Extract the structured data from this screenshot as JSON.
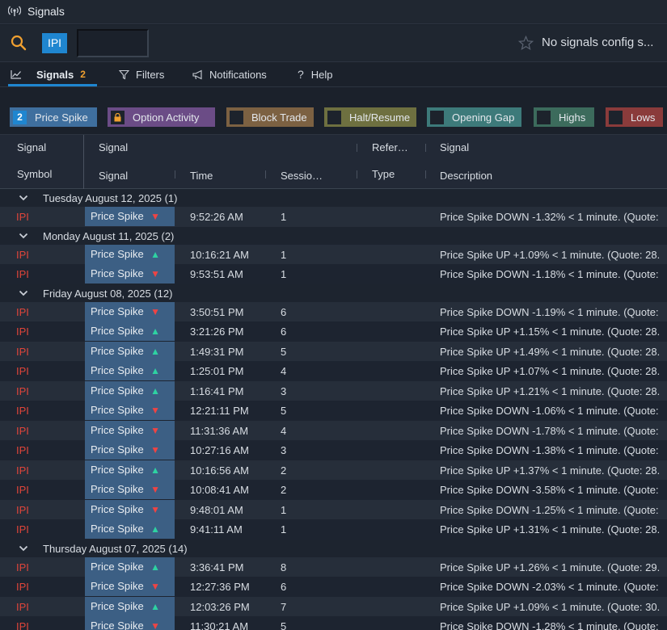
{
  "window": {
    "title": "Signals"
  },
  "symbol_bar": {
    "symbol": "IPI",
    "config_text": "No signals config s..."
  },
  "tabs": [
    {
      "label": "Signals",
      "count": "2"
    },
    {
      "label": "Filters"
    },
    {
      "label": "Notifications"
    },
    {
      "label": "Help"
    }
  ],
  "chips": {
    "price_spike": {
      "label": "Price Spike",
      "count": "2"
    },
    "option_activity": {
      "label": "Option Activity"
    },
    "block_trade": {
      "label": "Block Trade"
    },
    "halt_resume": {
      "label": "Halt/Resume"
    },
    "opening_gap": {
      "label": "Opening Gap"
    },
    "highs": {
      "label": "Highs"
    },
    "lows": {
      "label": "Lows"
    }
  },
  "grid": {
    "header_top": {
      "c1": "Signal",
      "c2": "Signal",
      "c3": "Refer…",
      "c4": "Signal"
    },
    "header_bottom": {
      "c1": "Symbol",
      "c2": "Signal",
      "c3": "Time",
      "c4": "Sessio…",
      "c5": "Type",
      "c6": "Description"
    }
  },
  "groups": [
    {
      "title": "Tuesday August 12, 2025",
      "count": "(1)",
      "rows": [
        {
          "symbol": "IPI",
          "signal": "Price Spike",
          "dir": "down",
          "time": "9:52:26 AM",
          "session": "1",
          "desc": "Price Spike DOWN -1.32% < 1 minute. (Quote:"
        }
      ]
    },
    {
      "title": "Monday August 11, 2025",
      "count": "(2)",
      "rows": [
        {
          "symbol": "IPI",
          "signal": "Price Spike",
          "dir": "up",
          "time": "10:16:21 AM",
          "session": "1",
          "desc": "Price Spike UP +1.09% < 1 minute. (Quote: 28."
        },
        {
          "symbol": "IPI",
          "signal": "Price Spike",
          "dir": "down",
          "time": "9:53:51 AM",
          "session": "1",
          "desc": "Price Spike DOWN -1.18% < 1 minute. (Quote:"
        }
      ]
    },
    {
      "title": "Friday August 08, 2025",
      "count": "(12)",
      "rows": [
        {
          "symbol": "IPI",
          "signal": "Price Spike",
          "dir": "down",
          "time": "3:50:51 PM",
          "session": "6",
          "desc": "Price Spike DOWN -1.19% < 1 minute. (Quote:"
        },
        {
          "symbol": "IPI",
          "signal": "Price Spike",
          "dir": "up",
          "time": "3:21:26 PM",
          "session": "6",
          "desc": "Price Spike UP +1.15% < 1 minute. (Quote: 28."
        },
        {
          "symbol": "IPI",
          "signal": "Price Spike",
          "dir": "up",
          "time": "1:49:31 PM",
          "session": "5",
          "desc": "Price Spike UP +1.49% < 1 minute. (Quote: 28."
        },
        {
          "symbol": "IPI",
          "signal": "Price Spike",
          "dir": "up",
          "time": "1:25:01 PM",
          "session": "4",
          "desc": "Price Spike UP +1.07% < 1 minute. (Quote: 28."
        },
        {
          "symbol": "IPI",
          "signal": "Price Spike",
          "dir": "up",
          "time": "1:16:41 PM",
          "session": "3",
          "desc": "Price Spike UP +1.21% < 1 minute. (Quote: 28."
        },
        {
          "symbol": "IPI",
          "signal": "Price Spike",
          "dir": "down",
          "time": "12:21:11 PM",
          "session": "5",
          "desc": "Price Spike DOWN -1.06% < 1 minute. (Quote:"
        },
        {
          "symbol": "IPI",
          "signal": "Price Spike",
          "dir": "down",
          "time": "11:31:36 AM",
          "session": "4",
          "desc": "Price Spike DOWN -1.78% < 1 minute. (Quote:"
        },
        {
          "symbol": "IPI",
          "signal": "Price Spike",
          "dir": "down",
          "time": "10:27:16 AM",
          "session": "3",
          "desc": "Price Spike DOWN -1.38% < 1 minute. (Quote:"
        },
        {
          "symbol": "IPI",
          "signal": "Price Spike",
          "dir": "up",
          "time": "10:16:56 AM",
          "session": "2",
          "desc": "Price Spike UP +1.37% < 1 minute. (Quote: 28."
        },
        {
          "symbol": "IPI",
          "signal": "Price Spike",
          "dir": "down",
          "time": "10:08:41 AM",
          "session": "2",
          "desc": "Price Spike DOWN -3.58% < 1 minute. (Quote:"
        },
        {
          "symbol": "IPI",
          "signal": "Price Spike",
          "dir": "down",
          "time": "9:48:01 AM",
          "session": "1",
          "desc": "Price Spike DOWN -1.25% < 1 minute. (Quote:"
        },
        {
          "symbol": "IPI",
          "signal": "Price Spike",
          "dir": "up",
          "time": "9:41:11 AM",
          "session": "1",
          "desc": "Price Spike UP +1.31% < 1 minute. (Quote: 28."
        }
      ]
    },
    {
      "title": "Thursday August 07, 2025",
      "count": "(14)",
      "rows": [
        {
          "symbol": "IPI",
          "signal": "Price Spike",
          "dir": "up",
          "time": "3:36:41 PM",
          "session": "8",
          "desc": "Price Spike UP +1.26% < 1 minute. (Quote: 29."
        },
        {
          "symbol": "IPI",
          "signal": "Price Spike",
          "dir": "down",
          "time": "12:27:36 PM",
          "session": "6",
          "desc": "Price Spike DOWN -2.03% < 1 minute. (Quote:"
        },
        {
          "symbol": "IPI",
          "signal": "Price Spike",
          "dir": "up",
          "time": "12:03:26 PM",
          "session": "7",
          "desc": "Price Spike UP +1.09% < 1 minute. (Quote: 30."
        },
        {
          "symbol": "IPI",
          "signal": "Price Spike",
          "dir": "down",
          "time": "11:30:21 AM",
          "session": "5",
          "desc": "Price Spike DOWN -1.28% < 1 minute. (Quote:"
        }
      ]
    }
  ]
}
